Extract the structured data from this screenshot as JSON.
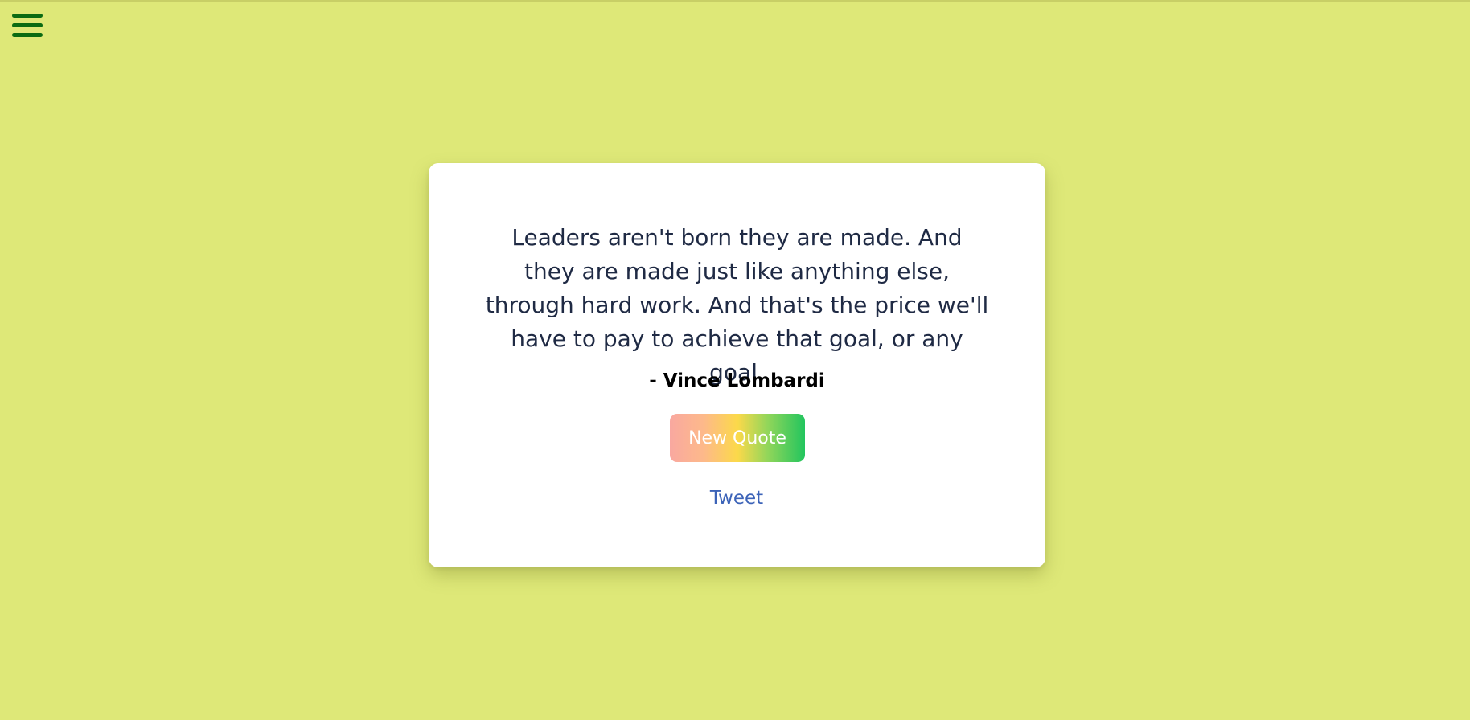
{
  "page": {
    "background_color": "#dee878"
  },
  "menu": {
    "icon": "hamburger-menu-icon",
    "color": "#0b6b12"
  },
  "quote": {
    "text": "Leaders aren't born they are made. And they are made just like anything else, through hard work. And that's the price we'll have to pay to achieve that goal, or any goal.",
    "author": "- Vince Lombardi"
  },
  "buttons": {
    "new_quote_label": "New Quote",
    "tweet_label": "Tweet"
  },
  "colors": {
    "quote_text": "#1f2a44",
    "tweet_link": "#3c63b8",
    "button_gradient": [
      "#f9a8a0",
      "#fcd94a",
      "#22c55e"
    ]
  }
}
